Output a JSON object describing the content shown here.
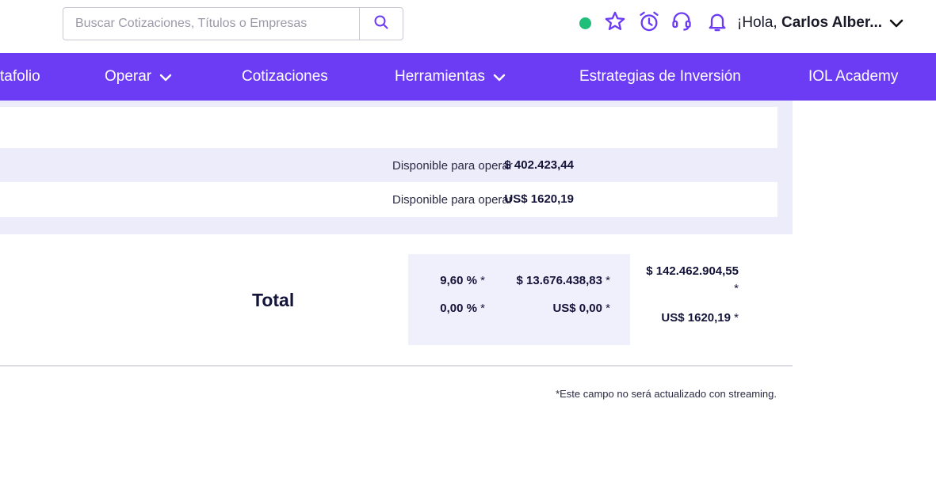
{
  "header": {
    "search": {
      "placeholder": "Buscar Cotizaciones, Títulos o Empresas"
    },
    "icons": [
      "search-icon",
      "status-online-indicator",
      "star-icon",
      "alarm-clock-icon",
      "headset-icon",
      "bell-icon",
      "chevron-down-icon"
    ],
    "greeting_prefix": "¡Hola,",
    "user_name": "Carlos Alber...",
    "status_color": "#1fbf7a"
  },
  "nav": {
    "accent_color": "#6c3cf5",
    "items": [
      {
        "label": "tafolio"
      },
      {
        "label": "Operar"
      },
      {
        "label": "Cotizaciones"
      },
      {
        "label": "Herramientas"
      },
      {
        "label": "Estrategias de Inversión"
      },
      {
        "label": "IOL Academy"
      }
    ]
  },
  "balances": [
    {
      "label": "Disponible para operar",
      "amount": "$ 402.423,44"
    },
    {
      "label": "Disponible para operar",
      "amount": "US$ 1620,19"
    }
  ],
  "totals": {
    "label": "Total",
    "rows": [
      {
        "percent": "9,60 %",
        "amount": "$ 13.676.438,83"
      },
      {
        "percent": "0,00 %",
        "amount": "US$ 0,00"
      }
    ],
    "grand_ars": "$ 142.462.904,55",
    "grand_usd": "US$ 1620,19",
    "asterisk": "*"
  },
  "footnote": "*Este campo no será actualizado con streaming."
}
